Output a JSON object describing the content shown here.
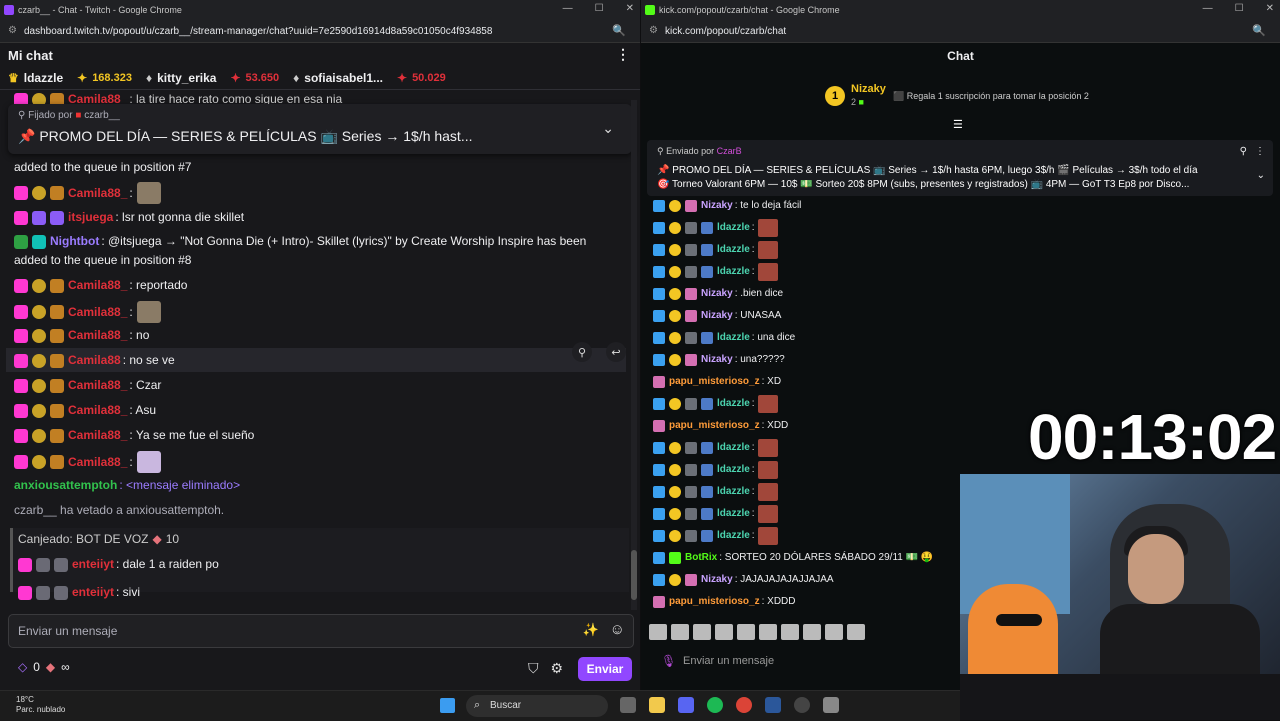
{
  "twitch_window": {
    "title": "czarb__ - Chat - Twitch - Google Chrome",
    "url": "dashboard.twitch.tv/popout/u/czarb__/stream-manager/chat?uuid=7e2590d16914d8a59c01050c4f934858",
    "header": "Mi chat",
    "leaderboard": [
      {
        "name": "ldazzle",
        "count": ""
      },
      {
        "name": "",
        "count": "168.323"
      },
      {
        "name": "kitty_erika",
        "count": ""
      },
      {
        "name": "",
        "count": "53.650"
      },
      {
        "name": "sofiaisabel1...",
        "count": ""
      },
      {
        "name": "",
        "count": "50.029"
      }
    ],
    "cut_line": ": la tire hace rato como sigue en esa nia",
    "cut_user": "Camila88_",
    "pinned": {
      "by_prefix": "Fijado por",
      "by_user": "czarb__",
      "text": "📌 PROMO DEL DÍA — SERIES & PELÍCULAS 📺 Series → 1$/h hast..."
    },
    "messages": [
      {
        "user": "",
        "text": "added to the queue in position #7"
      },
      {
        "user": "Camila88_",
        "text": ":"
      },
      {
        "user": "itsjuega",
        "text": ": lsr not gonna die skillet"
      },
      {
        "user": "Nightbot",
        "text": ": @itsjuega → \"Not Gonna Die (+ Intro)- Skillet (lyrics)\" by Create Worship Inspire has been"
      },
      {
        "user": "",
        "text": "added to the queue in position #8"
      },
      {
        "user": "Camila88_",
        "text": ": reportado"
      },
      {
        "user": "Camila88_",
        "text": ":"
      },
      {
        "user": "Camila88_",
        "text": ": no"
      },
      {
        "user": "Camila88",
        "text": ": no se ve"
      },
      {
        "user": "Camila88_",
        "text": ": Czar"
      },
      {
        "user": "Camila88_",
        "text": ": Asu"
      },
      {
        "user": "Camila88_",
        "text": ": Ya se me fue el sueño"
      },
      {
        "user": "Camila88_",
        "text": ":"
      },
      {
        "user": "anxiousattemptoh",
        "text": ": <mensaje eliminado>"
      },
      {
        "user": "",
        "text": "czarb__ ha vetado a anxiousattemptoh."
      },
      {
        "user": "",
        "text": "Canjeado: BOT DE VOZ"
      },
      {
        "user": "enteiiyt",
        "text": ": dale 1 a raiden po"
      },
      {
        "user": "enteiiyt",
        "text": ": sivi"
      }
    ],
    "redeem_cost": "10",
    "input_placeholder": "Enviar un mensaje",
    "points": "0",
    "points_extra": "∞",
    "send_label": "Enviar"
  },
  "kick_window": {
    "title": "kick.com/popout/czarb/chat - Google Chrome",
    "url": "kick.com/popout/czarb/chat",
    "header": "Chat",
    "top_gifter": {
      "rank": "1",
      "name": "Nizaky",
      "count": "2"
    },
    "gift_prompt": "Regala 1 suscripción para tomar la posición 2",
    "pinned": {
      "by_prefix": "Enviado por",
      "by_user": "CzarB",
      "line1": "📌 PROMO DEL DÍA — SERIES & PELÍCULAS 📺 Series → 1$/h hasta 6PM, luego 3$/h 🎬 Películas → 3$/h todo el día",
      "line2": "🎯 Torneo Valorant 6PM — 10$ 💵 Sorteo 20$ 8PM (subs, presentes y registrados) 📺 4PM — GoT T3 Ep8 por Disco..."
    },
    "messages": [
      {
        "user": "Nizaky",
        "text": ": te lo deja fácil"
      },
      {
        "user": "ldazzle",
        "text": ":"
      },
      {
        "user": "ldazzle",
        "text": ":"
      },
      {
        "user": "ldazzle",
        "text": ":"
      },
      {
        "user": "Nizaky",
        "text": ": .bien dice"
      },
      {
        "user": "Nizaky",
        "text": ": UNASAA"
      },
      {
        "user": "ldazzle",
        "text": ": una dice"
      },
      {
        "user": "Nizaky",
        "text": ": una?????"
      },
      {
        "user": "papu_misterioso_z",
        "text": ": XD"
      },
      {
        "user": "ldazzle",
        "text": ":"
      },
      {
        "user": "papu_misterioso_z",
        "text": ": XDD"
      },
      {
        "user": "ldazzle",
        "text": ":"
      },
      {
        "user": "ldazzle",
        "text": ":"
      },
      {
        "user": "ldazzle",
        "text": ":"
      },
      {
        "user": "ldazzle",
        "text": ":"
      },
      {
        "user": "ldazzle",
        "text": ":"
      },
      {
        "user": "BotRix",
        "text": ": SORTEO 20 DÓLARES SÁBADO 29/11 💵 🤑"
      },
      {
        "user": "Nizaky",
        "text": ": JAJAJAJAJAJJAJAA"
      },
      {
        "user": "papu_misterioso_z",
        "text": ": XDDD"
      }
    ],
    "input_placeholder": "Enviar un mensaje"
  },
  "overlay": {
    "timer": "00:13:02"
  },
  "taskbar": {
    "temp": "18°C",
    "weather": "Parc. nublado",
    "search_placeholder": "Buscar"
  },
  "colors": {
    "twitch_purple": "#9147ff",
    "kick_green": "#53fc18",
    "username_red": "#e0303a"
  }
}
